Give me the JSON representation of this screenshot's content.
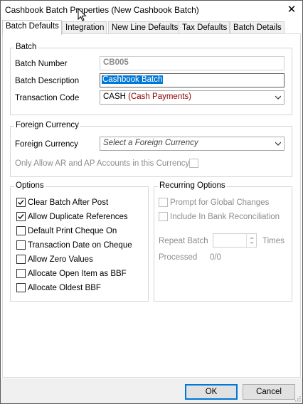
{
  "window": {
    "title": "Cashbook Batch Properties (New Cashbook Batch)",
    "close_glyph": "✕"
  },
  "tabs": [
    {
      "label": "Batch Defaults",
      "active": true
    },
    {
      "label": "Integration",
      "active": false
    },
    {
      "label": "New Line Defaults",
      "active": false
    },
    {
      "label": "Tax Defaults",
      "active": false
    },
    {
      "label": "Batch Details",
      "active": false
    }
  ],
  "batch": {
    "group_title": "Batch",
    "number_label": "Batch Number",
    "number_value": "CB005",
    "description_label": "Batch Description",
    "description_value": "Cashbook Batch",
    "transaction_code_label": "Transaction Code",
    "transaction_code_value": "CASH",
    "transaction_code_desc": "(Cash Payments)"
  },
  "foreign_currency": {
    "group_title": "Foreign Currency",
    "currency_label": "Foreign Currency",
    "currency_placeholder": "Select a Foreign Currency",
    "only_ar_ap_label": "Only Allow AR and AP Accounts in this Currency",
    "only_ar_ap_checked": false
  },
  "options": {
    "group_title": "Options",
    "items": [
      {
        "label": "Clear Batch After Post",
        "checked": true
      },
      {
        "label": "Allow Duplicate References",
        "checked": true
      },
      {
        "label": "Default Print Cheque On",
        "checked": false
      },
      {
        "label": "Transaction Date on Cheque",
        "checked": false
      },
      {
        "label": "Allow Zero Values",
        "checked": false
      },
      {
        "label": "Allocate Open Item as BBF",
        "checked": false
      },
      {
        "label": "Allocate Oldest BBF",
        "checked": false
      }
    ]
  },
  "recurring": {
    "group_title": "Recurring Options",
    "prompt_label": "Prompt for Global Changes",
    "include_label": "Include In Bank Reconciliation",
    "repeat_label": "Repeat Batch",
    "times_label": "Times",
    "processed_label": "Processed",
    "processed_value": "0/0"
  },
  "footer": {
    "ok_label": "OK",
    "cancel_label": "Cancel"
  },
  "colors": {
    "selection": "#0078d7",
    "transaction_desc": "#8b0000",
    "disabled_text": "#8c8c8c"
  }
}
